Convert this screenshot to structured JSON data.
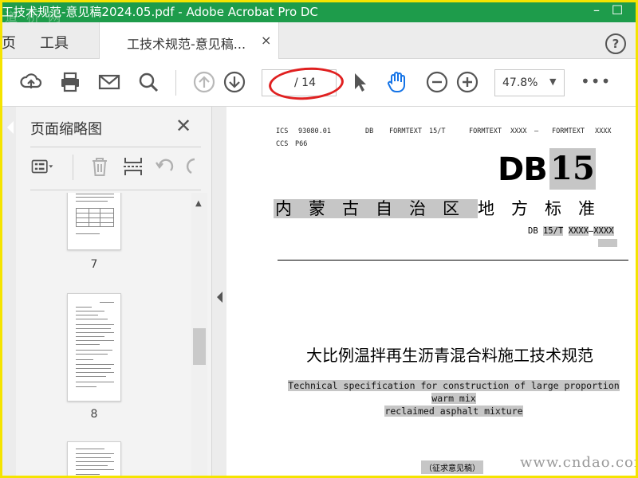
{
  "window": {
    "title": "工技术规范-意见稿2024.05.pdf - Adobe Acrobat Pro DC",
    "minimize": "–",
    "maximize": "☐",
    "watermark": "道 桥 网"
  },
  "tabs": {
    "home": "页",
    "tools": "工具",
    "document": "工技术规范-意见稿...",
    "close": "×",
    "help": "?"
  },
  "toolbar": {
    "icons": [
      "cloud-upload-icon",
      "print-icon",
      "mail-icon",
      "search-icon",
      "page-up-icon",
      "page-down-icon",
      "select-cursor-icon",
      "hand-tool-icon",
      "zoom-out-icon",
      "zoom-in-icon"
    ],
    "page_current": "",
    "page_total": "/ 14",
    "zoom": "47.8%",
    "zoom_caret": "▼",
    "more": "•••",
    "accent": "#1473e6"
  },
  "panel": {
    "title": "页面缩略图",
    "close": "✕",
    "thumbnails": [
      {
        "number": "7"
      },
      {
        "number": "8"
      }
    ]
  },
  "document": {
    "ics_label": "ICS",
    "ics_value": "93080.01",
    "ccs_label": "CCS",
    "ccs_value": "P66",
    "header_db": "DB",
    "header_formtext_1": "FORMTEXT",
    "header_15t": "15/T",
    "header_formtext_2": "FORMTEXT",
    "header_xxxx": "XXXX",
    "header_dash": "—",
    "header_formtext_3": "FORMTEXT",
    "header_xxxx_2": "XXXX",
    "logo_db": "DB",
    "logo_15": "15",
    "region_highlighted": "内蒙古自治区",
    "region_plain": "地方标准",
    "db_number_prefix": "DB",
    "db_number_15t": "15/T",
    "db_number_x1": "XXXX",
    "db_number_dash": "—",
    "db_number_x2": "XXXX",
    "title_cn": "大比例温拌再生沥青混合料施工技术规范",
    "title_en_line1": "Technical specification for construction of large proportion warm mix",
    "title_en_line2": "reclaimed asphalt mixture",
    "draft_label": "（征求意见稿）",
    "watermark": "www.cndao.com"
  },
  "colors": {
    "titlebar": "#1e9c4b",
    "frame": "#f5e400",
    "annotation_ring": "#e02020",
    "highlight": "#c6c6c6"
  }
}
